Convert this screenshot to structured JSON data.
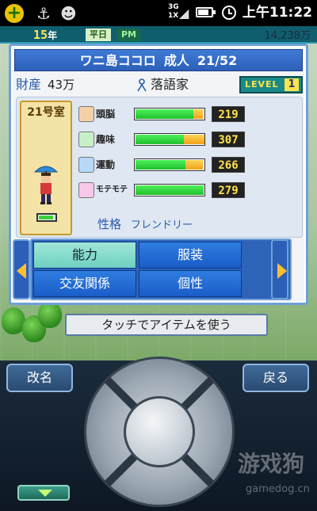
{
  "status_bar": {
    "network": "3G",
    "network2": "1X",
    "time": "上午11:22",
    "icons": [
      "plus-icon",
      "usb-icon",
      "android-icon",
      "signal-icon",
      "battery-icon",
      "alarm-icon"
    ]
  },
  "game_hud": {
    "day_number": "15",
    "day_unit": "年",
    "weekday_badge": "平日",
    "period_badge": "PM",
    "money": "14,238万"
  },
  "character": {
    "name": "ワニ島ココロ",
    "status": "成人",
    "count": "21/52",
    "assets_label": "財産",
    "assets_value": "43万",
    "job": "落語家",
    "level_label": "LEVEL",
    "level_value": "1",
    "room": "21号室",
    "personality_label": "性格",
    "personality_value": "フレンドリー"
  },
  "stats": [
    {
      "label": "頭脳",
      "value": "219",
      "green_pct": 0.82,
      "orange_pct": 0.14,
      "icon": "brain-icon"
    },
    {
      "label": "趣味",
      "value": "307",
      "green_pct": 0.68,
      "orange_pct": 0.3,
      "icon": "hobby-icon"
    },
    {
      "label": "運動",
      "value": "266",
      "green_pct": 0.7,
      "orange_pct": 0.24,
      "icon": "sports-icon"
    },
    {
      "label": "モテモテ",
      "value": "279",
      "green_pct": 0.95,
      "orange_pct": 0.0,
      "icon": "popularity-icon"
    }
  ],
  "tabs": [
    {
      "label": "能力",
      "active": true
    },
    {
      "label": "服装",
      "active": false
    },
    {
      "label": "交友関係",
      "active": false
    },
    {
      "label": "個性",
      "active": false
    }
  ],
  "touch_hint": "タッチでアイテムを使う",
  "controls": {
    "rename_label": "改名",
    "back_label": "戻る"
  },
  "watermark": {
    "main": "游戏狗",
    "sub": "gamedog.cn"
  },
  "colors": {
    "panel_border": "#6fa0d8",
    "title_bar": "#2c5fb8",
    "level_badge": "#1a8a8a",
    "stat_value_text": "#ffe34a",
    "stat_bar_green": "#1fbf2e",
    "stat_bar_orange": "#f0a21a"
  }
}
